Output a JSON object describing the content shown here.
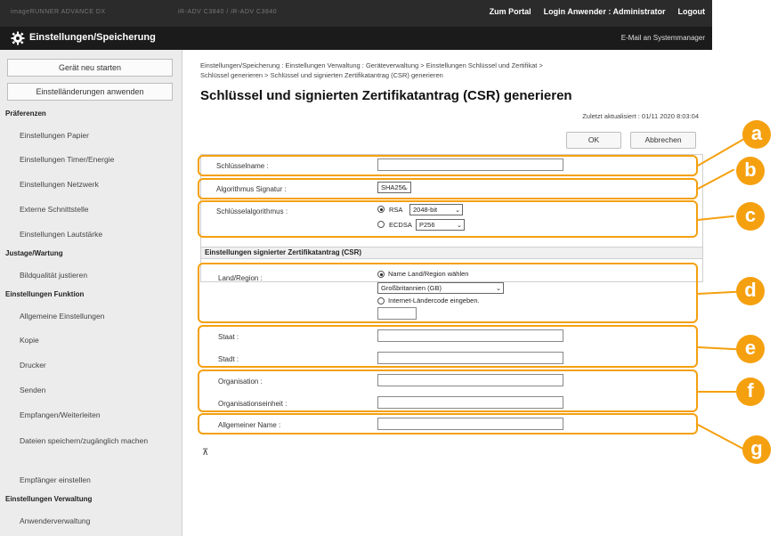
{
  "topbar": {
    "host_left": "imageRUNNER ADVANCE DX",
    "host_right": "iR-ADV C3840 / iR-ADV C3840",
    "links": [
      "Zum Portal",
      "Login Anwender : Administrator",
      "Logout"
    ]
  },
  "titlebar": {
    "title": "Einstellungen/Speicherung",
    "mail": "E-Mail an Systemmanager"
  },
  "sidebar": {
    "restart_button": "Gerät neu starten",
    "apply_button": "Einstelländerungen anwenden",
    "sections": [
      {
        "heading": "Präferenzen",
        "items": [
          "Einstellungen Papier",
          "Einstellungen Timer/Energie",
          "Einstellungen Netzwerk",
          "Externe Schnittstelle",
          "Einstellungen Lautstärke"
        ]
      },
      {
        "heading": "Justage/Wartung",
        "items": [
          "Bildqualität justieren"
        ]
      },
      {
        "heading": "Einstellungen Funktion",
        "items": [
          "Allgemeine Einstellungen",
          "Kopie",
          "Drucker",
          "Senden",
          "Empfangen/Weiterleiten",
          "Dateien speichern/zugänglich machen",
          "Empfänger einstellen"
        ]
      },
      {
        "heading": "Einstellungen Verwaltung",
        "items": [
          "Anwenderverwaltung"
        ]
      }
    ]
  },
  "main": {
    "breadcrumb_line1": "Einstellungen/Speicherung : Einstellungen Verwaltung : Geräteverwaltung > Einstellungen Schlüssel und Zertifikat >",
    "breadcrumb_line2": "Schlüssel generieren > Schlüssel und signierten Zertifikatantrag (CSR) generieren",
    "title": "Schlüssel und signierten Zertifikatantrag (CSR) generieren",
    "updated": "Zuletzt aktualisiert : 01/11 2020 8:03:04",
    "ok_button": "OK",
    "cancel_button": "Abbrechen",
    "key_name_label": "Schlüsselname :",
    "key_name_value": "",
    "sig_algo_label": "Algorithmus Signatur :",
    "sig_algo_value": "SHA256",
    "key_algo_label": "Schlüsselalgorithmus :",
    "rsa_label": "RSA",
    "rsa_value": "2048-bit",
    "ecdsa_label": "ECDSA",
    "ecdsa_value": "P256",
    "csr_section": "Einstellungen signierter Zertifikatantrag (CSR)",
    "country_label": "Land/Region :",
    "choose_name_label": "Name Land/Region wählen",
    "country_value": "Großbritannien (GB)",
    "internet_code_label": "Internet-Ländercode eingeben.",
    "state_label": "Staat :",
    "city_label": "Stadt :",
    "org_label": "Organisation :",
    "org_unit_label": "Organisationseinheit :",
    "common_name_label": "Allgemeiner Name :",
    "top_arrow": "⊼"
  },
  "callouts": [
    "a",
    "b",
    "c",
    "d",
    "e",
    "f",
    "g"
  ],
  "colors": {
    "accent": "#f5a00f",
    "titlebar": "#1b1b1b",
    "topbar": "#2b2b2b"
  }
}
